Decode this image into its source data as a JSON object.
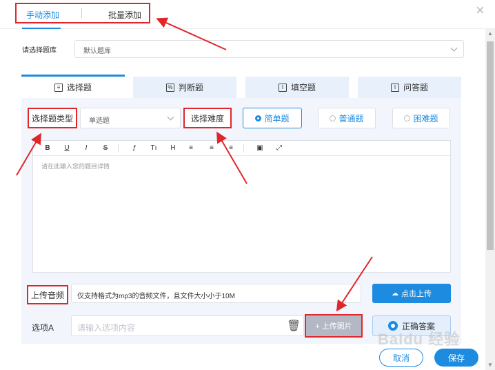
{
  "header": {
    "tabs": [
      {
        "label": "手动添加",
        "active": true
      },
      {
        "label": "批量添加",
        "active": false
      }
    ]
  },
  "question_bank": {
    "label": "请选择题库",
    "selected": "默认题库"
  },
  "question_tabs": [
    {
      "label": "选择题",
      "icon": "list-icon",
      "active": true
    },
    {
      "label": "判断题",
      "icon": "percent-icon",
      "active": false
    },
    {
      "label": "填空题",
      "icon": "text-cursor-icon",
      "active": false
    },
    {
      "label": "问答题",
      "icon": "text-cursor-icon",
      "active": false
    }
  ],
  "type_row": {
    "type_label": "选择题类型",
    "type_selected": "单选题",
    "difficulty_label": "选择难度",
    "difficulty_options": [
      {
        "label": "简单题",
        "selected": true
      },
      {
        "label": "普通题",
        "selected": false
      },
      {
        "label": "困难题",
        "selected": false
      }
    ]
  },
  "editor": {
    "toolbar": [
      "B",
      "U",
      "I",
      "S",
      "ƒ",
      "Tı",
      "H",
      "≡",
      "≡",
      "≡",
      "▣",
      "⤢"
    ],
    "placeholder": "请在此输入您的题目详情"
  },
  "audio": {
    "label": "上传音频",
    "hint": "仅支持格式为mp3的音频文件，且文件大小小于10M",
    "upload_button": "点击上传"
  },
  "option_a": {
    "label": "选项A",
    "placeholder": "请输入选项内容",
    "upload_image": "+ 上传图片",
    "correct_answer": "正确答案"
  },
  "footer": {
    "cancel": "取消",
    "save": "保存"
  },
  "watermark": "Baidu 经验",
  "colors": {
    "accent": "#1d8ce0",
    "annotation": "#e0262b",
    "tab_bg": "#e8f1fb",
    "panel_bg": "#f2f6fc"
  }
}
